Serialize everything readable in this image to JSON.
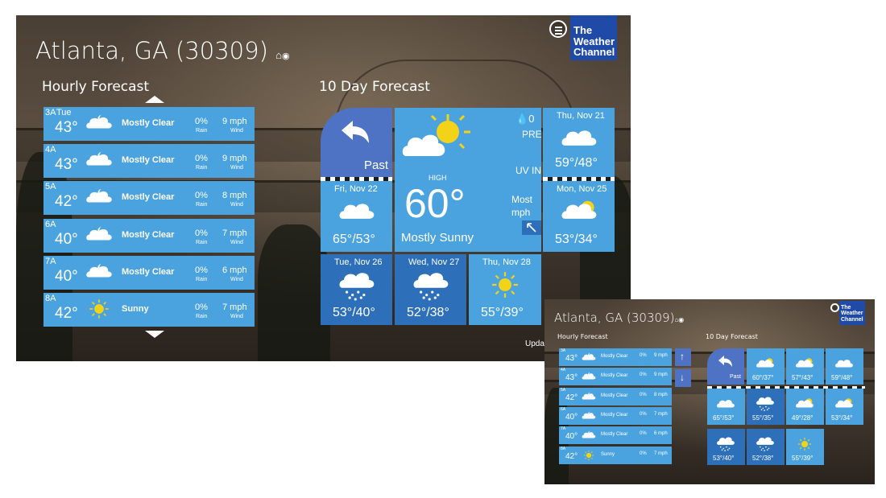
{
  "main": {
    "location": "Atlanta, GA (30309)",
    "logo": [
      "The",
      "Weather",
      "Channel"
    ],
    "hourly_title": "Hourly Forecast",
    "tenday_title": "10 Day Forecast",
    "hourly": [
      {
        "time": "3A",
        "day": "Tue",
        "temp": "43°",
        "icon": "partly-cloudy-night-icon",
        "cond": "Mostly Clear",
        "rain": "0%",
        "rain_label": "Rain",
        "wind": "9 mph",
        "wind_label": "Wind"
      },
      {
        "time": "4A",
        "day": "",
        "temp": "43°",
        "icon": "partly-cloudy-night-icon",
        "cond": "Mostly Clear",
        "rain": "0%",
        "rain_label": "Rain",
        "wind": "9 mph",
        "wind_label": "Wind"
      },
      {
        "time": "5A",
        "day": "",
        "temp": "42°",
        "icon": "partly-cloudy-night-icon",
        "cond": "Mostly Clear",
        "rain": "0%",
        "rain_label": "Rain",
        "wind": "8 mph",
        "wind_label": "Wind"
      },
      {
        "time": "6A",
        "day": "",
        "temp": "40°",
        "icon": "partly-cloudy-night-icon",
        "cond": "Mostly Clear",
        "rain": "0%",
        "rain_label": "Rain",
        "wind": "7 mph",
        "wind_label": "Wind"
      },
      {
        "time": "7A",
        "day": "",
        "temp": "40°",
        "icon": "partly-cloudy-night-icon",
        "cond": "Mostly Clear",
        "rain": "0%",
        "rain_label": "Rain",
        "wind": "6 mph",
        "wind_label": "Wind"
      },
      {
        "time": "8A",
        "day": "",
        "temp": "42°",
        "icon": "sun-icon",
        "cond": "Sunny",
        "rain": "0%",
        "rain_label": "Rain",
        "wind": "7 mph",
        "wind_label": "Wind"
      }
    ],
    "past_label": "Past",
    "today": {
      "high_label": "HIGH",
      "temp": "60°",
      "cond": "Mostly Sunny",
      "precip": "0",
      "pre_label": "PRE",
      "uv_label": "UV IN",
      "most_label": "Most",
      "mph_label": "mph"
    },
    "tiles": [
      {
        "day": "Thu, Nov 21",
        "temps": "59°/48°",
        "icon": "cloud-icon"
      },
      {
        "day": "Fri, Nov 22",
        "temps": "65°/53°",
        "icon": "cloud-icon"
      },
      {
        "day": "Mon, Nov 25",
        "temps": "53°/34°",
        "icon": "partly-sunny-icon"
      },
      {
        "day": "Tue, Nov 26",
        "temps": "53°/40°",
        "icon": "rain-icon"
      },
      {
        "day": "Wed, Nov 27",
        "temps": "52°/38°",
        "icon": "rain-icon"
      },
      {
        "day": "Thu, Nov 28",
        "temps": "55°/39°",
        "icon": "sun-icon"
      }
    ],
    "update_text": "Upda"
  },
  "small": {
    "location": "Atlanta, GA (30309)",
    "logo": [
      "The",
      "Weather",
      "Channel"
    ],
    "hourly_title": "Hourly Forecast",
    "tenday_title": "10 Day Forecast",
    "hourly": [
      {
        "time": "3A",
        "temp": "43°",
        "cond": "Mostly Clear",
        "rain": "0%",
        "wind": "9 mph",
        "icon": "partly-cloudy-night-icon"
      },
      {
        "time": "4A",
        "temp": "43°",
        "cond": "Mostly Clear",
        "rain": "0%",
        "wind": "9 mph",
        "icon": "partly-cloudy-night-icon"
      },
      {
        "time": "5A",
        "temp": "42°",
        "cond": "Mostly Clear",
        "rain": "0%",
        "wind": "8 mph",
        "icon": "partly-cloudy-night-icon"
      },
      {
        "time": "6A",
        "temp": "40°",
        "cond": "Mostly Clear",
        "rain": "0%",
        "wind": "7 mph",
        "icon": "partly-cloudy-night-icon"
      },
      {
        "time": "7A",
        "temp": "40°",
        "cond": "Mostly Clear",
        "rain": "0%",
        "wind": "6 mph",
        "icon": "partly-cloudy-night-icon"
      },
      {
        "time": "8A",
        "temp": "42°",
        "cond": "Sunny",
        "rain": "0%",
        "wind": "7 mph",
        "icon": "sun-icon"
      }
    ],
    "past_label": "Past",
    "tiles": [
      {
        "temps": "60°/37°",
        "icon": "partly-sunny-icon",
        "style": "light"
      },
      {
        "temps": "57°/43°",
        "icon": "partly-sunny-icon",
        "style": "light"
      },
      {
        "temps": "59°/48°",
        "icon": "cloud-icon",
        "style": "light"
      },
      {
        "temps": "65°/53°",
        "icon": "cloud-icon",
        "style": "light"
      },
      {
        "temps": "55°/35°",
        "icon": "rain-icon",
        "style": "dark"
      },
      {
        "temps": "49°/28°",
        "icon": "partly-sunny-icon",
        "style": "light"
      },
      {
        "temps": "53°/34°",
        "icon": "partly-sunny-icon",
        "style": "light"
      },
      {
        "temps": "53°/40°",
        "icon": "rain-icon",
        "style": "dark"
      },
      {
        "temps": "52°/38°",
        "icon": "rain-icon",
        "style": "dark"
      },
      {
        "temps": "55°/39°",
        "icon": "sun-icon",
        "style": "light"
      }
    ]
  },
  "colors": {
    "tile": "#4aa3df",
    "tile_dark": "#2d6fb8",
    "past": "#4e73c4",
    "logo": "#1f4aa8",
    "sun": "#f3d21a"
  }
}
